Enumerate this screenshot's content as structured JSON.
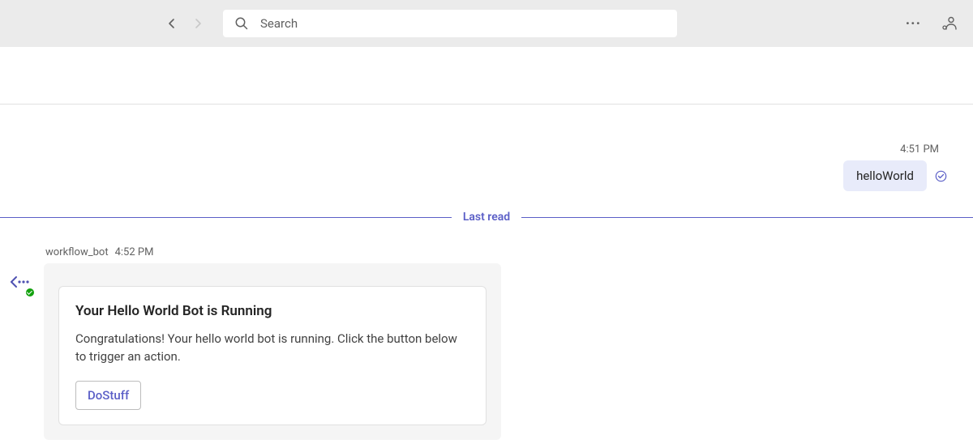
{
  "header": {
    "search_placeholder": "Search"
  },
  "chat": {
    "user_message": {
      "time": "4:51 PM",
      "text": "helloWorld"
    },
    "divider_label": "Last read",
    "bot_message": {
      "sender": "workflow_bot",
      "time": "4:52 PM",
      "card": {
        "title": "Your Hello World Bot is Running",
        "body": "Congratulations! Your hello world bot is running. Click the button below to trigger an action.",
        "button_label": "DoStuff"
      }
    }
  }
}
